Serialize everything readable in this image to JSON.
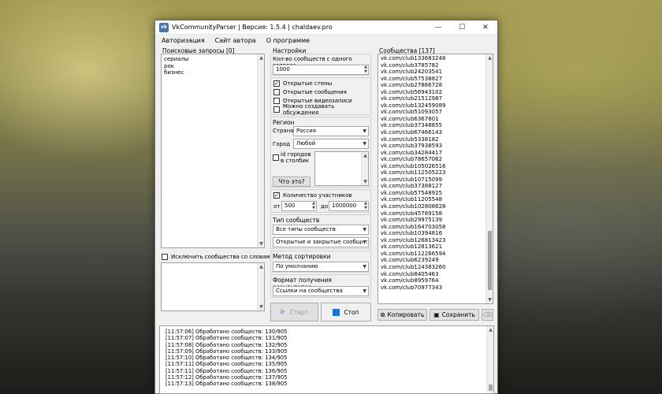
{
  "window": {
    "title": "VkCommunityParser | Версия: 1.5.4 | chaldaev.pro",
    "app_icon": "vk-icon",
    "minimize": "—",
    "maximize": "☐",
    "close": "✕"
  },
  "menu": [
    "Авторизация",
    "Сайт автора",
    "О программе"
  ],
  "search": {
    "label": "Поисковые запросы [0]",
    "items": [
      "сериалы",
      "рок",
      "бизнес"
    ],
    "exclude_label": "Исключить сообщества со словами:"
  },
  "settings": {
    "label": "Настройки",
    "count_label": "Кол-во сообществ с одного запроса",
    "count_value": "1000",
    "checks": [
      {
        "label": "Открытые стены",
        "checked": true
      },
      {
        "label": "Открытые сообщения",
        "checked": false
      },
      {
        "label": "Открытые видеозаписи",
        "checked": false
      },
      {
        "label": "Можно создавать обсуждения",
        "checked": false
      }
    ],
    "region_label": "Регион",
    "country_label": "Страна",
    "country_value": "Россия",
    "city_label": "Город",
    "city_value": "Любой",
    "city_ids_label_1": "id городов",
    "city_ids_label_2": "в столбик",
    "whats_this": "Что это?",
    "members_label": "Количество участников",
    "members_checked": true,
    "from_label": "от",
    "from_value": "500",
    "to_label": "до",
    "to_value": "1000000",
    "type_label": "Тип сообществ",
    "type_value": "Все типы сообществ",
    "privacy_value": "Открытые и закрытые сообщества",
    "sort_label": "Метод сортировки результатов",
    "sort_value": "По умолчанию",
    "format_label": "Формат получения результатов",
    "format_value": "Ссылки на сообщества",
    "start": "Старт",
    "stop": "Стоп"
  },
  "results": {
    "label": "Сообщества [137]",
    "items": [
      "vk.com/club133683248",
      "vk.com/club3785782",
      "vk.com/club24203541",
      "vk.com/club57538827",
      "vk.com/club27866728",
      "vk.com/club56943102",
      "vk.com/club21512987",
      "vk.com/club132459089",
      "vk.com/club51093057",
      "vk.com/club6367801",
      "vk.com/club37348855",
      "vk.com/club67466143",
      "vk.com/club5338182",
      "vk.com/club37938593",
      "vk.com/club34284417",
      "vk.com/club78657062",
      "vk.com/club105026516",
      "vk.com/club112505223",
      "vk.com/club10715099",
      "vk.com/club37388127",
      "vk.com/club57548925",
      "vk.com/club11205548",
      "vk.com/club102808628",
      "vk.com/club45789158",
      "vk.com/club29975139",
      "vk.com/club164703058",
      "vk.com/club10394816",
      "vk.com/club126813423",
      "vk.com/club12813621",
      "vk.com/club112266594",
      "vk.com/club6239249",
      "vk.com/club124383260",
      "vk.com/club8405463",
      "vk.com/club8959764",
      "vk.com/club70977343"
    ],
    "copy": "Копировать",
    "save": "Сохранить"
  },
  "log": [
    "[11:57:06] Обработано сообществ: 130/905",
    "[11:57:07] Обработано сообществ: 131/905",
    "[11:57:08] Обработано сообществ: 132/905",
    "[11:57:09] Обработано сообществ: 133/905",
    "[11:57:10] Обработано сообществ: 134/905",
    "[11:57:11] Обработано сообществ: 135/905",
    "[11:57:11] Обработано сообществ: 136/905",
    "[11:57:12] Обработано сообществ: 137/905",
    "[11:57:13] Обработано сообществ: 138/905"
  ]
}
